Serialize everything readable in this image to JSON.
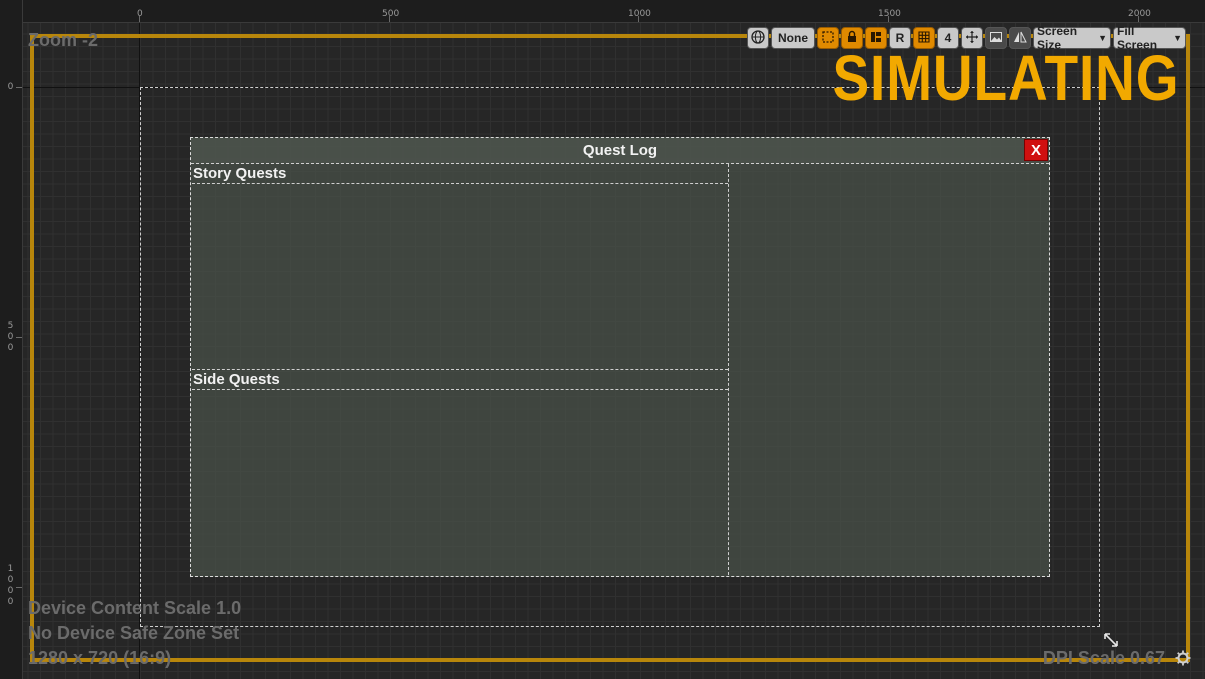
{
  "ruler": {
    "top_ticks": [
      "0",
      "500",
      "1000",
      "1500",
      "2000"
    ],
    "left_ticks": [
      [
        "0"
      ],
      [
        "5",
        "0",
        "0"
      ],
      [
        "1",
        "0",
        "0",
        "0"
      ]
    ]
  },
  "viewport": {
    "zoom_label": "Zoom -2",
    "simulating_label": "SIMULATING",
    "device_content_scale": "Device Content Scale 1.0",
    "safe_zone": "No Device Safe Zone Set",
    "resolution": "1280 x 720 (16:9)",
    "dpi_scale": "DPI Scale 0.67"
  },
  "toolbar": {
    "localize_value": "None",
    "respect_locks_label": "R",
    "grid_snap_value": "4",
    "screen_size_label": "Screen Size",
    "fill_screen_label": "Fill Screen"
  },
  "widget": {
    "title": "Quest Log",
    "close_label": "X",
    "story_quests_label": "Story Quests",
    "side_quests_label": "Side Quests"
  },
  "colors": {
    "simulating": "#f2a900",
    "frame": "#b8860b",
    "close_button": "#d01010",
    "toolbar_active": "#e08a00"
  }
}
